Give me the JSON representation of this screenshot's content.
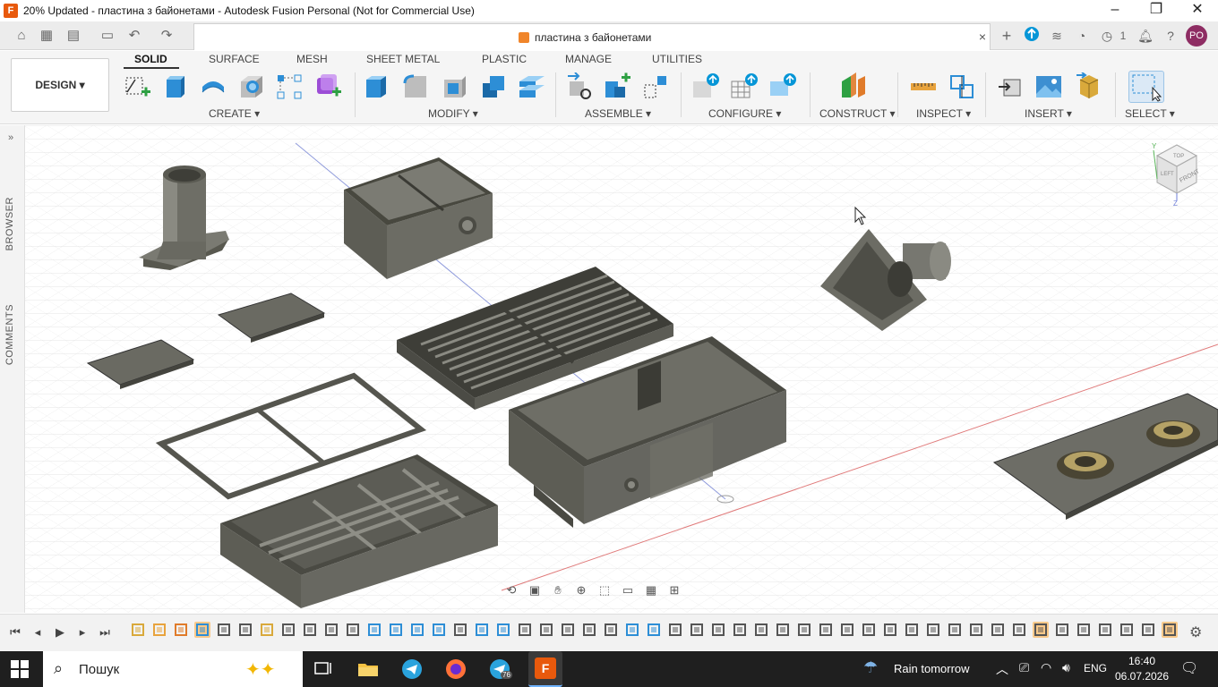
{
  "window": {
    "title": "20% Updated - пластина з байонетами - Autodesk Fusion Personal (Not for Commercial Use)",
    "app_icon_letter": "F"
  },
  "document_tab": {
    "title": "пластина з байонетами",
    "close": "×"
  },
  "right_icons": {
    "jobs_count": "1",
    "user_initials": "PO"
  },
  "toolbar": {
    "workspace_button": "DESIGN ▾",
    "workspace_tabs": [
      {
        "label": "SOLID",
        "active": true
      },
      {
        "label": "SURFACE",
        "active": false
      },
      {
        "label": "MESH",
        "active": false
      },
      {
        "label": "SHEET METAL",
        "active": false
      },
      {
        "label": "PLASTIC",
        "active": false
      },
      {
        "label": "MANAGE",
        "active": false
      },
      {
        "label": "UTILITIES",
        "active": false
      }
    ],
    "groups": [
      {
        "label": "CREATE ▾"
      },
      {
        "label": "MODIFY ▾"
      },
      {
        "label": "ASSEMBLE ▾"
      },
      {
        "label": "CONFIGURE ▾"
      },
      {
        "label": "CONSTRUCT ▾"
      },
      {
        "label": "INSPECT ▾"
      },
      {
        "label": "INSERT ▾"
      },
      {
        "label": "SELECT ▾"
      }
    ]
  },
  "side_panel": {
    "browser_label": "BROWSER",
    "comments_label": "COMMENTS"
  },
  "viewcube": {
    "top": "TOP",
    "front": "FRONT",
    "left": "LEFT",
    "axis_y": "Y",
    "axis_z": "Z"
  },
  "taskbar": {
    "search_placeholder": "Пошук",
    "weather": "Rain tomorrow",
    "language": "ENG",
    "time": "16:40",
    "date": "06.07.2026",
    "telegram_badge": "76"
  },
  "colors": {
    "accent": "#0696d7",
    "part_gray": "#6d6d66",
    "part_dark": "#4a4a45",
    "timeline_highlight": "#f9c98a",
    "fusion_orange": "#e8590c"
  }
}
